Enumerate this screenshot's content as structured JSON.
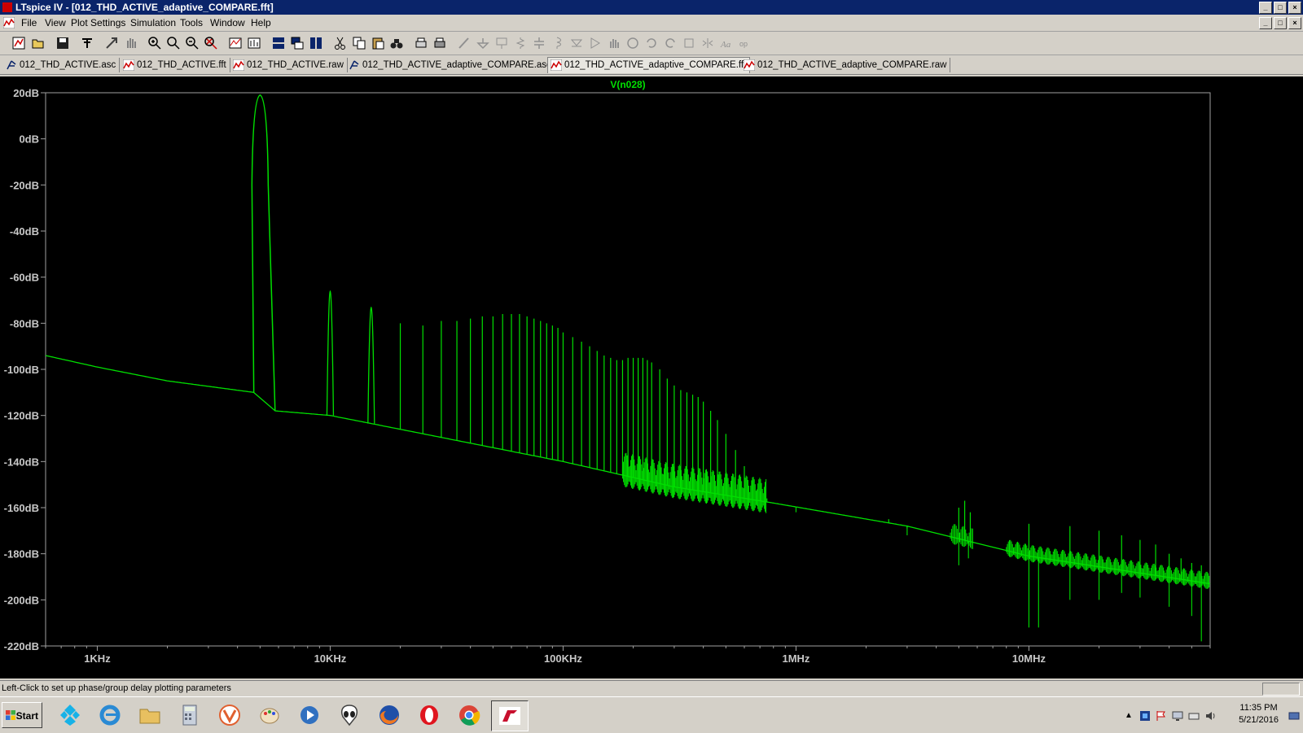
{
  "window": {
    "title": "LTspice IV - [012_THD_ACTIVE_adaptive_COMPARE.fft]",
    "controls": [
      "_",
      "□",
      "×"
    ]
  },
  "menu": [
    "File",
    "View",
    "Plot Settings",
    "Simulation",
    "Tools",
    "Window",
    "Help"
  ],
  "tabs": [
    {
      "label": "012_THD_ACTIVE.asc",
      "icon": "schematic-icon",
      "active": false
    },
    {
      "label": "012_THD_ACTIVE.fft",
      "icon": "waveform-icon",
      "active": false
    },
    {
      "label": "012_THD_ACTIVE.raw",
      "icon": "waveform-icon",
      "active": false
    },
    {
      "label": "012_THD_ACTIVE_adaptive_COMPARE.asc",
      "icon": "schematic-icon",
      "active": false
    },
    {
      "label": "012_THD_ACTIVE_adaptive_COMPARE.fft",
      "icon": "waveform-icon",
      "active": true
    },
    {
      "label": "012_THD_ACTIVE_adaptive_COMPARE.raw",
      "icon": "waveform-icon",
      "active": false
    }
  ],
  "chart_data": {
    "type": "line",
    "title": "V(n028)",
    "xlabel": "",
    "ylabel": "",
    "xscale": "log",
    "xlim": [
      600,
      60000000
    ],
    "ylim": [
      -220,
      20
    ],
    "grid": false,
    "background": "#000000",
    "trace_color": "#00e000",
    "yticks": [
      "20dB",
      "0dB",
      "-20dB",
      "-40dB",
      "-60dB",
      "-80dB",
      "-100dB",
      "-120dB",
      "-140dB",
      "-160dB",
      "-180dB",
      "-200dB",
      "-220dB"
    ],
    "xticks": [
      {
        "value": 1000,
        "label": "1KHz"
      },
      {
        "value": 10000,
        "label": "10KHz"
      },
      {
        "value": 100000,
        "label": "100KHz"
      },
      {
        "value": 1000000,
        "label": "1MHz"
      },
      {
        "value": 10000000,
        "label": "10MHz"
      }
    ],
    "series": [
      {
        "name": "V(n028)",
        "floor": [
          [
            600,
            -94
          ],
          [
            1000,
            -99
          ],
          [
            2000,
            -105
          ],
          [
            4700,
            -110
          ],
          [
            5800,
            -118
          ],
          [
            10000,
            -120
          ],
          [
            20000,
            -126
          ],
          [
            100000,
            -140
          ],
          [
            300000,
            -151
          ],
          [
            800000,
            -158
          ],
          [
            3000000,
            -168
          ],
          [
            10000000,
            -181
          ],
          [
            60000000,
            -193
          ]
        ],
        "peaks": [
          [
            5000,
            19
          ],
          [
            10000,
            -66
          ],
          [
            15000,
            -73
          ],
          [
            20000,
            -80
          ],
          [
            25000,
            -81
          ],
          [
            30000,
            -79
          ],
          [
            35000,
            -79
          ],
          [
            40000,
            -78
          ],
          [
            45000,
            -77
          ],
          [
            50000,
            -77
          ],
          [
            55000,
            -76
          ],
          [
            60000,
            -76
          ],
          [
            65000,
            -76
          ],
          [
            70000,
            -77
          ],
          [
            75000,
            -78
          ],
          [
            80000,
            -79
          ],
          [
            85000,
            -80
          ],
          [
            90000,
            -81
          ],
          [
            95000,
            -82
          ],
          [
            100000,
            -84
          ],
          [
            110000,
            -86
          ],
          [
            120000,
            -88
          ],
          [
            130000,
            -90
          ],
          [
            140000,
            -92
          ],
          [
            150000,
            -94
          ],
          [
            160000,
            -95
          ],
          [
            170000,
            -96
          ],
          [
            180000,
            -96
          ],
          [
            190000,
            -95
          ],
          [
            200000,
            -95
          ],
          [
            210000,
            -95
          ],
          [
            220000,
            -95
          ],
          [
            230000,
            -96
          ],
          [
            240000,
            -97
          ],
          [
            260000,
            -100
          ],
          [
            280000,
            -104
          ],
          [
            300000,
            -107
          ],
          [
            320000,
            -109
          ],
          [
            340000,
            -110
          ],
          [
            360000,
            -111
          ],
          [
            380000,
            -112
          ],
          [
            400000,
            -114
          ],
          [
            430000,
            -118
          ],
          [
            460000,
            -122
          ],
          [
            500000,
            -128
          ],
          [
            550000,
            -135
          ],
          [
            600000,
            -142
          ],
          [
            650000,
            -148
          ],
          [
            700000,
            -153
          ],
          [
            750000,
            -156
          ],
          [
            2500000,
            -165
          ],
          [
            3000000,
            -169
          ],
          [
            5000000,
            -160
          ],
          [
            5300000,
            -157
          ],
          [
            5600000,
            -162
          ],
          [
            10000000,
            -167
          ],
          [
            15000000,
            -168
          ],
          [
            20000000,
            -170
          ],
          [
            25000000,
            -172
          ],
          [
            30000000,
            -174
          ],
          [
            35000000,
            -176
          ],
          [
            40000000,
            -180
          ],
          [
            45000000,
            -182
          ],
          [
            50000000,
            -184
          ],
          [
            55000000,
            -185
          ]
        ],
        "dips": [
          [
            1000000,
            -162
          ],
          [
            3000000,
            -172
          ],
          [
            5000000,
            -185
          ],
          [
            5500000,
            -182
          ],
          [
            10000000,
            -212
          ],
          [
            11000000,
            -212
          ],
          [
            15000000,
            -200
          ],
          [
            20000000,
            -200
          ],
          [
            25000000,
            -197
          ],
          [
            30000000,
            -199
          ],
          [
            40000000,
            -203
          ],
          [
            50000000,
            -207
          ],
          [
            55000000,
            -218
          ]
        ]
      }
    ]
  },
  "status": {
    "message": "Left-Click to set up phase/group delay plotting parameters"
  },
  "taskbar": {
    "start_label": "Start",
    "apps": [
      "kodi-icon",
      "internet-explorer-icon",
      "file-explorer-icon",
      "calculator-icon",
      "vivaldi-icon",
      "paint-icon",
      "media-player-icon",
      "alien-icon",
      "firefox-icon",
      "opera-icon",
      "chrome-icon",
      "ltspice-icon"
    ],
    "clock_time": "11:35 PM",
    "clock_date": "5/21/2016"
  }
}
